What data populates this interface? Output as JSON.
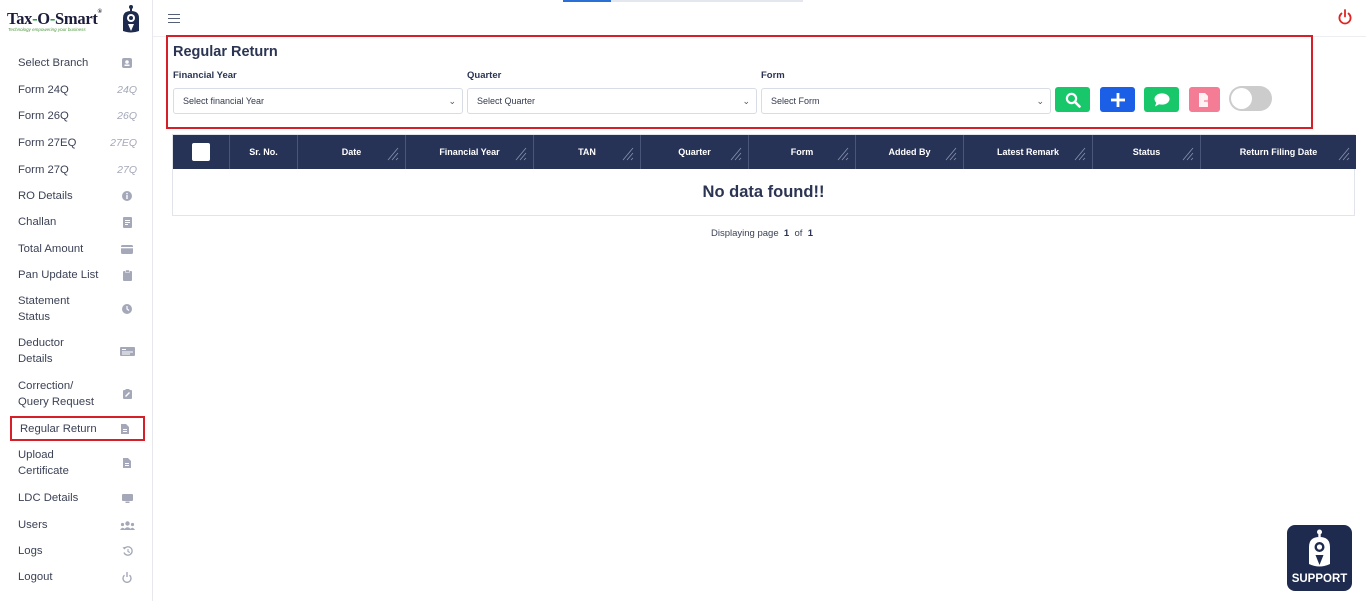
{
  "brand": {
    "name_part1": "Tax",
    "name_dash1": "-",
    "name_part2": "O",
    "name_dash2": "-",
    "name_part3": "Smart",
    "tagline": "Technology empowering your business"
  },
  "sidebar": {
    "items": [
      {
        "label": "Select Branch",
        "icon": "id-card-icon"
      },
      {
        "label": "Form 24Q",
        "icon_text": "24Q"
      },
      {
        "label": "Form 26Q",
        "icon_text": "26Q"
      },
      {
        "label": "Form 27EQ",
        "icon_text": "27EQ"
      },
      {
        "label": "Form 27Q",
        "icon_text": "27Q"
      },
      {
        "label": "RO Details",
        "icon": "info-icon"
      },
      {
        "label": "Challan",
        "icon": "receipt-icon"
      },
      {
        "label": "Total Amount",
        "icon": "wallet-icon"
      },
      {
        "label": "Pan Update List",
        "icon": "clipboard-icon"
      },
      {
        "label": "Statement Status",
        "label_line1": "Statement",
        "label_line2": "Status",
        "icon": "clock-icon"
      },
      {
        "label": "Deductor Details",
        "label_line1": "Deductor",
        "label_line2": "Details",
        "icon": "card-icon"
      },
      {
        "label": "Correction/ Query Request",
        "label_line1": "Correction/",
        "label_line2": "Query Request",
        "icon": "edit-doc-icon"
      },
      {
        "label": "Regular Return",
        "icon": "file-icon"
      },
      {
        "label": "Upload Certificate",
        "label_line1": "Upload",
        "label_line2": "Certificate",
        "icon": "file-icon"
      },
      {
        "label": "LDC Details",
        "icon": "monitor-icon"
      },
      {
        "label": "Users",
        "icon": "users-icon"
      },
      {
        "label": "Logs",
        "icon": "history-icon"
      },
      {
        "label": "Logout",
        "icon": "power-icon"
      }
    ],
    "active": "Regular Return"
  },
  "page": {
    "title": "Regular Return"
  },
  "filters": {
    "financial_year": {
      "label": "Financial Year",
      "value": "Select financial Year"
    },
    "quarter": {
      "label": "Quarter",
      "value": "Select Quarter"
    },
    "form": {
      "label": "Form",
      "value": "Select Form"
    }
  },
  "table": {
    "columns": [
      "Sr. No.",
      "Date",
      "Financial Year",
      "TAN",
      "Quarter",
      "Form",
      "Added By",
      "Latest Remark",
      "Status",
      "Return Filing Date"
    ],
    "empty_message": "No data found!!"
  },
  "pager": {
    "prefix": "Displaying page",
    "current": "1",
    "of": "of",
    "total": "1"
  },
  "support": {
    "label": "SUPPORT"
  },
  "colors": {
    "navy": "#273356",
    "accent_red": "#d61f26",
    "green": "#19c76b",
    "blue": "#1a5fe6",
    "pink": "#f47c94"
  }
}
